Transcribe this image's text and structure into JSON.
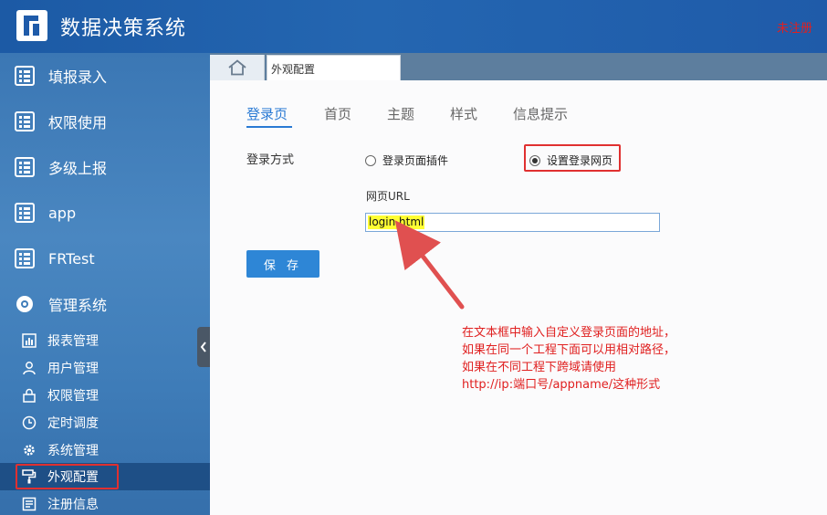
{
  "header": {
    "title": "数据决策系统",
    "unregistered": "未注册"
  },
  "sidebar": {
    "main_items": [
      {
        "label": "填报录入",
        "icon": "grid-icon"
      },
      {
        "label": "权限使用",
        "icon": "grid-icon"
      },
      {
        "label": "多级上报",
        "icon": "grid-icon"
      },
      {
        "label": "app",
        "icon": "grid-icon"
      },
      {
        "label": "FRTest",
        "icon": "grid-icon"
      },
      {
        "label": "管理系统",
        "icon": "gear-flower-icon"
      }
    ],
    "sub_items": [
      {
        "label": "报表管理",
        "icon": "chart-icon"
      },
      {
        "label": "用户管理",
        "icon": "user-icon"
      },
      {
        "label": "权限管理",
        "icon": "lock-icon"
      },
      {
        "label": "定时调度",
        "icon": "clock-icon"
      },
      {
        "label": "系统管理",
        "icon": "gear-icon"
      },
      {
        "label": "外观配置",
        "icon": "paint-roller-icon",
        "active": true
      },
      {
        "label": "注册信息",
        "icon": "register-icon"
      }
    ]
  },
  "tabs": {
    "page_tab": "外观配置"
  },
  "content": {
    "subtabs": [
      "登录页",
      "首页",
      "主题",
      "样式",
      "信息提示"
    ],
    "active_subtab": "登录页",
    "login_method_label": "登录方式",
    "radio_plugin": "登录页面插件",
    "radio_url": "设置登录网页",
    "selected_radio": "设置登录网页",
    "url_label": "网页URL",
    "url_value": "login.html",
    "save_label": "保 存"
  },
  "annotation": {
    "lines": [
      "在文本框中输入自定义登录页面的地址，",
      "如果在同一个工程下面可以用相对路径，",
      "如果在不同工程下跨域请使用",
      "http://ip:端口号/appname/这种形式"
    ]
  },
  "colors": {
    "accent": "#2a7ad4",
    "header": "#1f5ba9",
    "highlight": "#e03030"
  }
}
